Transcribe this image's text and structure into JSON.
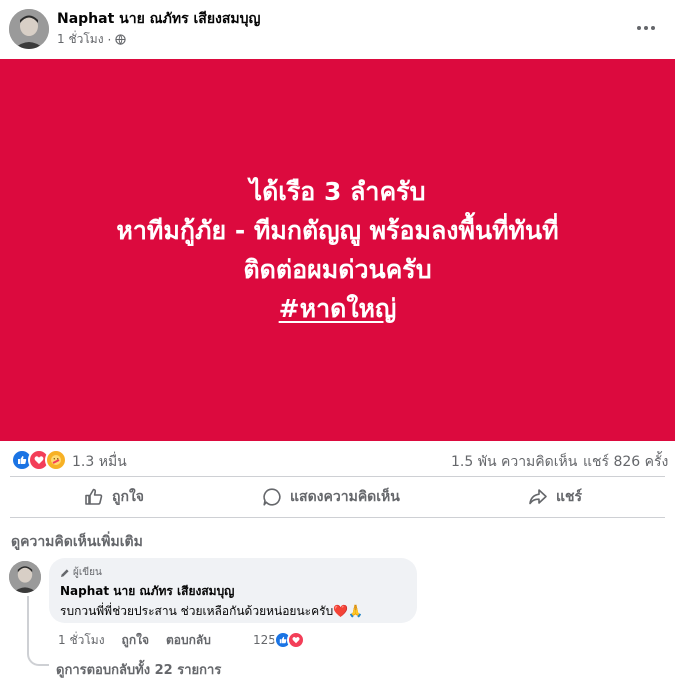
{
  "post": {
    "author": "Naphat นาย ณภัทร เสียงสมบุญ",
    "time": "1 ชั่วโมง",
    "privacy_icon": "globe-icon",
    "more_icon": "ellipsis-icon"
  },
  "banner": {
    "background": "#dc0a3e",
    "line1": "ได้เรือ 3 ลำครับ",
    "line2": "หาทีมกู้ภัย - ทีมกตัญญู พร้อมลงพื้นที่ทันที่",
    "line3": "ติดต่อผมด่วนครับ",
    "hashtag": "#หาดใหญ่"
  },
  "stats": {
    "reaction_icons": [
      "like-icon",
      "love-icon",
      "care-icon"
    ],
    "reactions": "1.3 หมื่น",
    "comments": "1.5 พัน ความคิดเห็น",
    "shares": "แชร์ 826 ครั้ง"
  },
  "actions": {
    "like": "ถูกใจ",
    "comment": "แสดงความคิดเห็น",
    "share": "แชร์"
  },
  "comments_section": {
    "more_label": "ดูความคิดเห็นเพิ่มเติม",
    "comment": {
      "badge": "ผู้เขียน",
      "author": "Naphat นาย ณภัทร เสียงสมบุญ",
      "text": "รบกวนพี่พี่ช่วยประสาน ช่วยเหลือกันด้วยหน่อยนะครับ",
      "emoji": "❤️🙏",
      "time": "1 ชั่วโมง",
      "like": "ถูกใจ",
      "reply": "ตอบกลับ",
      "reaction_count": "125",
      "reaction_icons": [
        "like-icon",
        "love-icon"
      ]
    },
    "view_replies": "ดูการตอบกลับทั้ง 22 รายการ"
  }
}
